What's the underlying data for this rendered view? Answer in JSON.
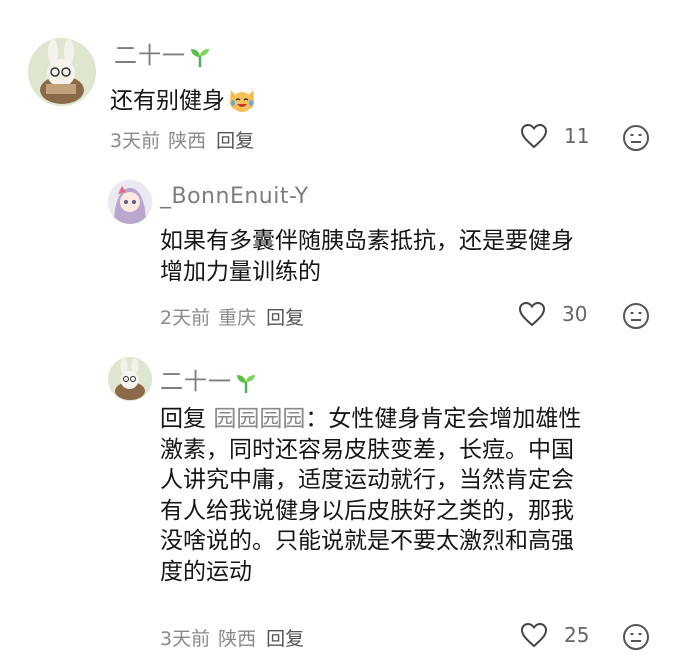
{
  "comments": [
    {
      "author": "二十一",
      "text": "还有别健身",
      "time": "3天前",
      "location": "陕西",
      "reply_label": "回复",
      "likes": "11"
    },
    {
      "author": "_BonnEnuit-Y",
      "text_line1": "如果有多囊伴随胰岛素抵抗，还是要健身",
      "text_line2": "增加力量训练的",
      "time": "2天前",
      "location": "重庆",
      "reply_label": "回复",
      "likes": "30"
    },
    {
      "author": "二十一",
      "reply_prefix": "回复",
      "mention": "园园园园",
      "lines": [
        "：女性健身肯定会增加雄性",
        "激素，同时还容易皮肤变差，长痘。中国",
        "人讲究中庸，适度运动就行，当然肯定会",
        "有人给我说健身以后皮肤好之类的，那我",
        "没啥说的。只能说就是不要太激烈和高强",
        "度的运动"
      ],
      "time": "3天前",
      "location": "陕西",
      "reply_label": "回复",
      "likes": "25"
    }
  ]
}
